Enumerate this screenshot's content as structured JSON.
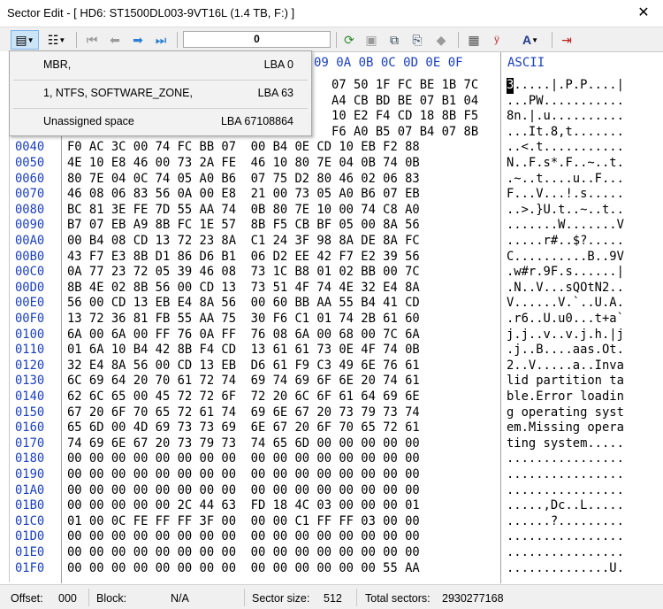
{
  "window": {
    "title": "Sector Edit - [ HD6: ST1500DL003-9VT16L (1.4 TB, F:) ]",
    "close_glyph": "✕"
  },
  "toolbar": {
    "sector_value": "0",
    "icons": [
      "partition-menu-icon",
      "view-menu-icon",
      "first-sector-icon",
      "prev-sector-icon",
      "next-sector-icon",
      "last-sector-icon",
      "refresh-icon",
      "save-icon",
      "copy-sectors-icon",
      "paste-sectors-icon",
      "fill-icon",
      "calculator-icon",
      "charset-icon",
      "font-icon",
      "exit-icon"
    ]
  },
  "partition_menu": [
    {
      "label": "MBR,",
      "lba": "LBA 0"
    },
    {
      "label": "1, NTFS, SOFTWARE_ZONE,",
      "lba": "LBA 63"
    },
    {
      "label": "Unassigned space",
      "lba": "LBA 67108864"
    }
  ],
  "hex": {
    "columns_visible": "09 0A 0B 0C 0D 0E 0F",
    "ascii_header": "ASCII",
    "rows": [
      {
        "off": "",
        "bytes": "                                    07 50 1F FC BE 1B 7C",
        "ascii": "3.....|.P.P....|"
      },
      {
        "off": "",
        "bytes": "                                    A4 CB BD BE 07 B1 04",
        "ascii": "...PW..........."
      },
      {
        "off": "",
        "bytes": "                                    10 E2 F4 CD 18 8B F5",
        "ascii": "8n.|.u.........."
      },
      {
        "off": "",
        "bytes": "                                    F6 A0 B5 07 B4 07 8B",
        "ascii": "...It.8,t......."
      },
      {
        "off": "0040",
        "bytes": "F0 AC 3C 00 74 FC BB 07  00 B4 0E CD 10 EB F2 88",
        "ascii": "..<.t..........."
      },
      {
        "off": "0050",
        "bytes": "4E 10 E8 46 00 73 2A FE  46 10 80 7E 04 0B 74 0B",
        "ascii": "N..F.s*.F..~..t."
      },
      {
        "off": "0060",
        "bytes": "80 7E 04 0C 74 05 A0 B6  07 75 D2 80 46 02 06 83",
        "ascii": ".~..t....u..F..."
      },
      {
        "off": "0070",
        "bytes": "46 08 06 83 56 0A 00 E8  21 00 73 05 A0 B6 07 EB",
        "ascii": "F...V...!.s....."
      },
      {
        "off": "0080",
        "bytes": "BC 81 3E FE 7D 55 AA 74  0B 80 7E 10 00 74 C8 A0",
        "ascii": "..>.}U.t..~..t.."
      },
      {
        "off": "0090",
        "bytes": "B7 07 EB A9 8B FC 1E 57  8B F5 CB BF 05 00 8A 56",
        "ascii": ".......W.......V"
      },
      {
        "off": "00A0",
        "bytes": "00 B4 08 CD 13 72 23 8A  C1 24 3F 98 8A DE 8A FC",
        "ascii": ".....r#..$?....."
      },
      {
        "off": "00B0",
        "bytes": "43 F7 E3 8B D1 86 D6 B1  06 D2 EE 42 F7 E2 39 56",
        "ascii": "C..........B..9V"
      },
      {
        "off": "00C0",
        "bytes": "0A 77 23 72 05 39 46 08  73 1C B8 01 02 BB 00 7C",
        "ascii": ".w#r.9F.s......|"
      },
      {
        "off": "00D0",
        "bytes": "8B 4E 02 8B 56 00 CD 13  73 51 4F 74 4E 32 E4 8A",
        "ascii": ".N..V...sQOtN2.."
      },
      {
        "off": "00E0",
        "bytes": "56 00 CD 13 EB E4 8A 56  00 60 BB AA 55 B4 41 CD",
        "ascii": "V......V.`..U.A."
      },
      {
        "off": "00F0",
        "bytes": "13 72 36 81 FB 55 AA 75  30 F6 C1 01 74 2B 61 60",
        "ascii": ".r6..U.u0...t+a`"
      },
      {
        "off": "0100",
        "bytes": "6A 00 6A 00 FF 76 0A FF  76 08 6A 00 68 00 7C 6A",
        "ascii": "j.j..v..v.j.h.|j"
      },
      {
        "off": "0110",
        "bytes": "01 6A 10 B4 42 8B F4 CD  13 61 61 73 0E 4F 74 0B",
        "ascii": ".j..B....aas.Ot."
      },
      {
        "off": "0120",
        "bytes": "32 E4 8A 56 00 CD 13 EB  D6 61 F9 C3 49 6E 76 61",
        "ascii": "2..V.....a..Inva"
      },
      {
        "off": "0130",
        "bytes": "6C 69 64 20 70 61 72 74  69 74 69 6F 6E 20 74 61",
        "ascii": "lid partition ta"
      },
      {
        "off": "0140",
        "bytes": "62 6C 65 00 45 72 72 6F  72 20 6C 6F 61 64 69 6E",
        "ascii": "ble.Error loadin"
      },
      {
        "off": "0150",
        "bytes": "67 20 6F 70 65 72 61 74  69 6E 67 20 73 79 73 74",
        "ascii": "g operating syst"
      },
      {
        "off": "0160",
        "bytes": "65 6D 00 4D 69 73 73 69  6E 67 20 6F 70 65 72 61",
        "ascii": "em.Missing opera"
      },
      {
        "off": "0170",
        "bytes": "74 69 6E 67 20 73 79 73  74 65 6D 00 00 00 00 00",
        "ascii": "ting system....."
      },
      {
        "off": "0180",
        "bytes": "00 00 00 00 00 00 00 00  00 00 00 00 00 00 00 00",
        "ascii": "................"
      },
      {
        "off": "0190",
        "bytes": "00 00 00 00 00 00 00 00  00 00 00 00 00 00 00 00",
        "ascii": "................"
      },
      {
        "off": "01A0",
        "bytes": "00 00 00 00 00 00 00 00  00 00 00 00 00 00 00 00",
        "ascii": "................"
      },
      {
        "off": "01B0",
        "bytes": "00 00 00 00 00 2C 44 63  FD 18 4C 03 00 00 00 01",
        "ascii": ".....,Dc..L....."
      },
      {
        "off": "01C0",
        "bytes": "01 00 0C FE FF FF 3F 00  00 00 C1 FF FF 03 00 00",
        "ascii": "......?........."
      },
      {
        "off": "01D0",
        "bytes": "00 00 00 00 00 00 00 00  00 00 00 00 00 00 00 00",
        "ascii": "................"
      },
      {
        "off": "01E0",
        "bytes": "00 00 00 00 00 00 00 00  00 00 00 00 00 00 00 00",
        "ascii": "................"
      },
      {
        "off": "01F0",
        "bytes": "00 00 00 00 00 00 00 00  00 00 00 00 00 00 55 AA",
        "ascii": "..............U."
      }
    ]
  },
  "status": {
    "offset_label": "Offset:",
    "offset_value": "000",
    "block_label": "Block:",
    "block_value": "N/A",
    "sector_size_label": "Sector size:",
    "sector_size_value": "512",
    "total_label": "Total sectors:",
    "total_value": "2930277168"
  },
  "colors": {
    "offset_blue": "#1a3fbd",
    "menu_bg": "#f2f2f2"
  }
}
